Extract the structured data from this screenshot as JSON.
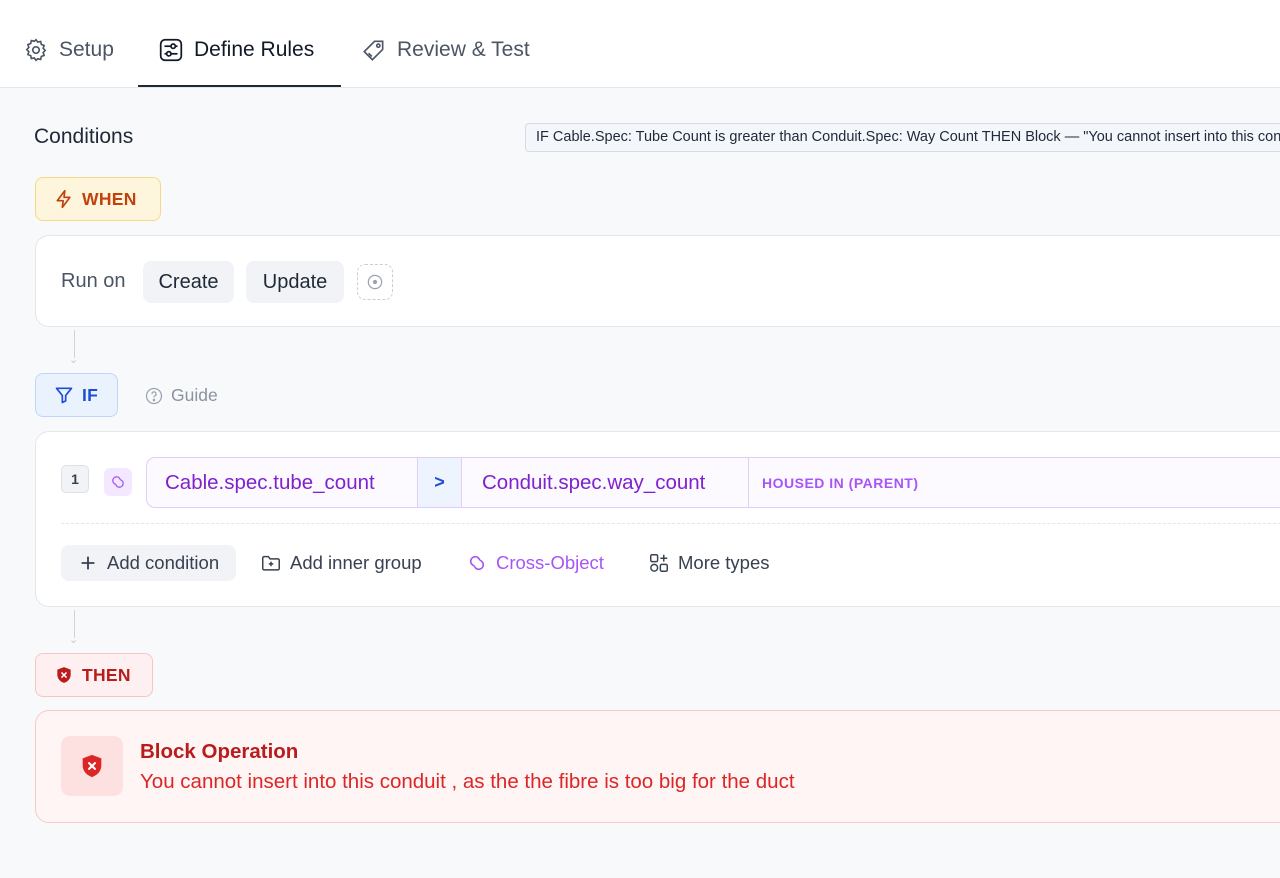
{
  "tabs": [
    {
      "label": "Setup",
      "icon": "gear-icon",
      "active": false
    },
    {
      "label": "Define Rules",
      "icon": "sliders-icon",
      "active": true
    },
    {
      "label": "Review & Test",
      "icon": "tag-icon",
      "active": false
    }
  ],
  "conditions": {
    "title": "Conditions",
    "summary": "IF Cable.Spec: Tube Count is greater than Conduit.Spec: Way Count THEN Block — \"You cannot insert into this conduit , as the the fibre is too big for the duct\""
  },
  "when": {
    "label": "WHEN",
    "run_on_label": "Run on",
    "triggers": [
      "Create",
      "Update"
    ]
  },
  "if": {
    "label": "IF",
    "guide_label": "Guide",
    "rows": [
      {
        "number": "1",
        "left_field": "Cable.spec.tube_count",
        "operator": ">",
        "right_field": "Conduit.spec.way_count",
        "relation": "HOUSED IN (PARENT)"
      }
    ],
    "actions": {
      "add_condition": "Add condition",
      "add_inner_group": "Add inner group",
      "cross_object": "Cross-Object",
      "more_types": "More types"
    }
  },
  "then": {
    "label": "THEN",
    "action_title": "Block Operation",
    "message": "You cannot insert into this conduit , as the the fibre is too big for the duct"
  },
  "colors": {
    "when_accent": "#c2410c",
    "if_accent": "#1d4ed8",
    "then_accent": "#b91c1c",
    "cross_object": "#a855f7"
  }
}
